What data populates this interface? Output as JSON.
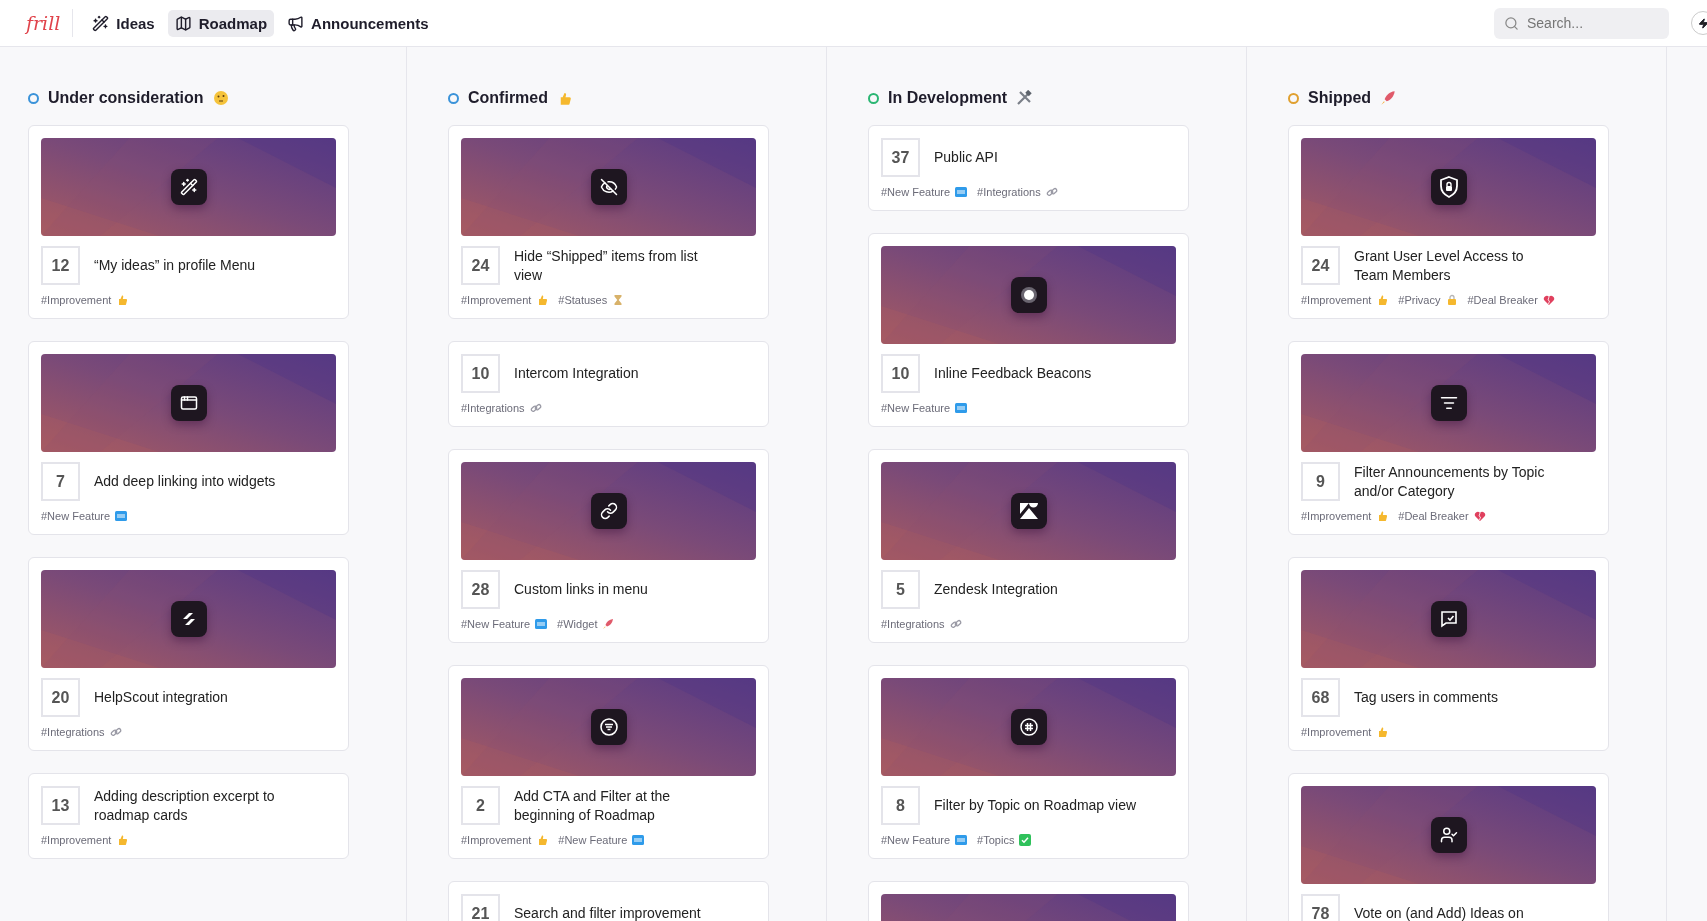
{
  "nav": {
    "logo": "frill",
    "items": [
      {
        "label": "Ideas",
        "selected": false
      },
      {
        "label": "Roadmap",
        "selected": true
      },
      {
        "label": "Announcements",
        "selected": false
      }
    ],
    "search": {
      "placeholder": "Search..."
    }
  },
  "columns": [
    {
      "title": "Under consideration",
      "color": "#3b93d9",
      "kind": "thinking",
      "cards": [
        {
          "votes": "12",
          "title": "“My ideas” in profile Menu",
          "cover": {
            "kind": "wand"
          },
          "tags": [
            {
              "label": "#Improvement",
              "kind": "thumbs-up"
            }
          ]
        },
        {
          "votes": "7",
          "title": "Add deep linking into widgets",
          "cover": {
            "kind": "windows"
          },
          "tags": [
            {
              "label": "#New Feature",
              "kind": "new"
            }
          ]
        },
        {
          "votes": "20",
          "title": "HelpScout integration",
          "cover": {
            "kind": "slashes"
          },
          "tags": [
            {
              "label": "#Integrations",
              "kind": "link"
            }
          ]
        },
        {
          "votes": "13",
          "title": "Adding description excerpt to roadmap cards",
          "tags": [
            {
              "label": "#Improvement",
              "kind": "thumbs-up"
            }
          ]
        }
      ]
    },
    {
      "title": "Confirmed",
      "color": "#3b93d9",
      "kind": "thumbs-up",
      "cards": [
        {
          "votes": "24",
          "title": "Hide “Shipped” items from list view",
          "cover": {
            "kind": "eye-off"
          },
          "tags": [
            {
              "label": "#Improvement",
              "kind": "thumbs-up"
            },
            {
              "label": "#Statuses",
              "kind": "hourglass"
            }
          ]
        },
        {
          "votes": "10",
          "title": "Intercom Integration",
          "tags": [
            {
              "label": "#Integrations",
              "kind": "link"
            }
          ]
        },
        {
          "votes": "28",
          "title": "Custom links in menu",
          "cover": {
            "kind": "link"
          },
          "tags": [
            {
              "label": "#New Feature",
              "kind": "new"
            },
            {
              "label": "#Widget",
              "kind": "rocket"
            }
          ]
        },
        {
          "votes": "2",
          "title": "Add CTA and Filter at the beginning of Roadmap",
          "cover": {
            "kind": "filter-circle"
          },
          "tags": [
            {
              "label": "#Improvement",
              "kind": "thumbs-up"
            },
            {
              "label": "#New Feature",
              "kind": "new"
            }
          ]
        },
        {
          "votes": "21",
          "title": "Search and filter improvement"
        }
      ]
    },
    {
      "title": "In Development",
      "color": "#2bb673",
      "kind": "tools",
      "cards": [
        {
          "votes": "37",
          "title": "Public API",
          "tags": [
            {
              "label": "#New Feature",
              "kind": "new"
            },
            {
              "label": "#Integrations",
              "kind": "link"
            }
          ]
        },
        {
          "votes": "10",
          "title": "Inline Feedback Beacons",
          "cover": {
            "kind": "beacon"
          },
          "tags": [
            {
              "label": "#New Feature",
              "kind": "new"
            }
          ]
        },
        {
          "votes": "5",
          "title": "Zendesk Integration",
          "cover": {
            "kind": "zendesk"
          },
          "tags": [
            {
              "label": "#Integrations",
              "kind": "link"
            }
          ]
        },
        {
          "votes": "8",
          "title": "Filter by Topic on Roadmap view",
          "cover": {
            "kind": "hash"
          },
          "tags": [
            {
              "label": "#New Feature",
              "kind": "new"
            },
            {
              "label": "#Topics",
              "kind": "check"
            }
          ]
        },
        {
          "cover": {
            "kind": "none"
          }
        }
      ]
    },
    {
      "title": "Shipped",
      "color": "#e0a030",
      "kind": "rocket",
      "cards": [
        {
          "votes": "24",
          "title": "Grant User Level Access to Team Members",
          "cover": {
            "kind": "shield"
          },
          "tags": [
            {
              "label": "#Improvement",
              "kind": "thumbs-up"
            },
            {
              "label": "#Privacy",
              "kind": "lock"
            },
            {
              "label": "#Deal Breaker",
              "kind": "broken-heart"
            }
          ]
        },
        {
          "votes": "9",
          "title": "Filter Announcements by Topic and/or Category",
          "cover": {
            "kind": "filter"
          },
          "tags": [
            {
              "label": "#Improvement",
              "kind": "thumbs-up"
            },
            {
              "label": "#Deal Breaker",
              "kind": "broken-heart"
            }
          ]
        },
        {
          "votes": "68",
          "title": "Tag users in comments",
          "cover": {
            "kind": "message-check"
          },
          "tags": [
            {
              "label": "#Improvement",
              "kind": "thumbs-up"
            }
          ]
        },
        {
          "votes": "78",
          "title": "Vote on (and Add) Ideas on",
          "cover": {
            "kind": "user-check"
          }
        }
      ]
    }
  ]
}
